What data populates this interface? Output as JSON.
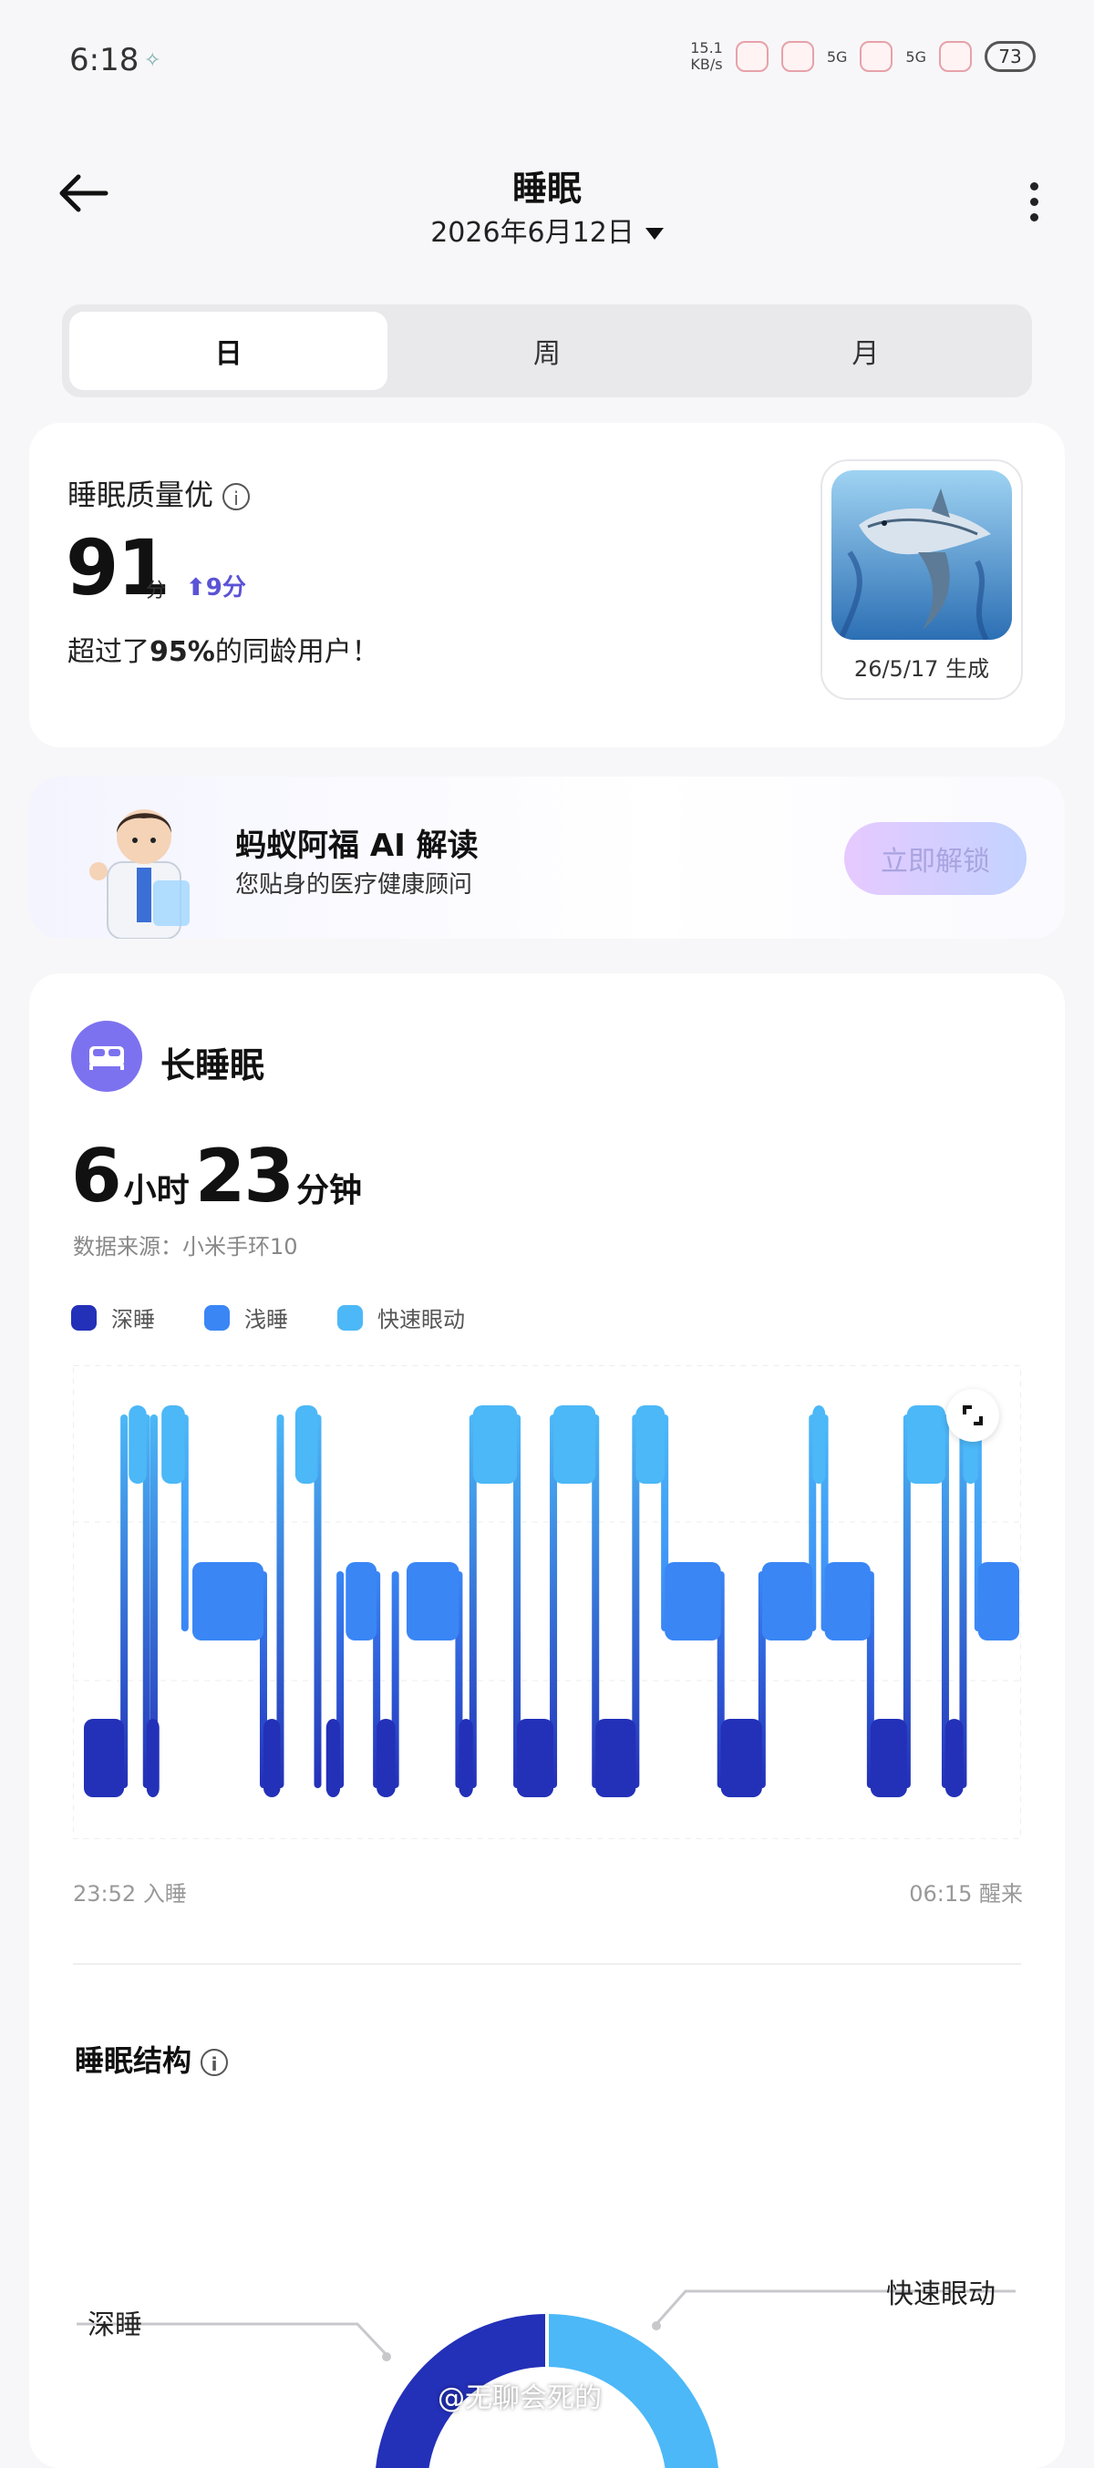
{
  "status": {
    "time": "6:18",
    "net_speed_value": "15.1",
    "net_speed_unit": "KB/s",
    "sig1": "5G",
    "sig2": "5G",
    "battery": "73"
  },
  "header": {
    "title": "睡眠",
    "date": "2026年6月12日"
  },
  "tabs": [
    {
      "label": "日",
      "active": true
    },
    {
      "label": "周",
      "active": false
    },
    {
      "label": "月",
      "active": false
    }
  ],
  "score_card": {
    "label": "睡眠质量优",
    "score": "91",
    "unit": "分",
    "delta": "9分",
    "compare_prefix": "超过了",
    "compare_pct": "95%",
    "compare_suffix": "的同龄用户！",
    "badge_caption": "26/5/17 生成"
  },
  "ai_card": {
    "title": "蚂蚁阿福 AI 解读",
    "subtitle": "您贴身的医疗健康顾问",
    "button": "立即解锁"
  },
  "sleep": {
    "section_title": "长睡眠",
    "hours": "6",
    "hours_unit": "小时",
    "minutes": "23",
    "minutes_unit": "分钟",
    "source": "数据来源：小米手环10",
    "start_time": "23:52",
    "start_label": "入睡",
    "end_time": "06:15",
    "end_label": "醒来",
    "structure_title": "睡眠结构",
    "structure_label_deep": "深睡",
    "structure_label_rem": "快速眼动"
  },
  "colors": {
    "deep": "#2330b8",
    "light": "#3a86f5",
    "rem": "#4cb8f7",
    "accent": "#7c72ef"
  },
  "chart_data": {
    "type": "bar",
    "legend": [
      "深睡",
      "浅睡",
      "快速眼动"
    ],
    "stages": [
      "快速眼动",
      "浅睡",
      "深睡"
    ],
    "segments": [
      {
        "stage": "深睡",
        "start": 0.0,
        "end": 4.3
      },
      {
        "stage": "快速眼动",
        "start": 4.8,
        "end": 6.7
      },
      {
        "stage": "深睡",
        "start": 6.7,
        "end": 7.5
      },
      {
        "stage": "快速眼动",
        "start": 8.3,
        "end": 10.8
      },
      {
        "stage": "浅睡",
        "start": 11.6,
        "end": 19.2
      },
      {
        "stage": "深睡",
        "start": 19.2,
        "end": 21.0
      },
      {
        "stage": "快速眼动",
        "start": 22.6,
        "end": 25.0
      },
      {
        "stage": "深睡",
        "start": 25.9,
        "end": 27.4
      },
      {
        "stage": "浅睡",
        "start": 28.0,
        "end": 31.3
      },
      {
        "stage": "深睡",
        "start": 31.3,
        "end": 33.3
      },
      {
        "stage": "浅睡",
        "start": 34.5,
        "end": 40.1
      },
      {
        "stage": "深睡",
        "start": 40.1,
        "end": 41.6
      },
      {
        "stage": "快速眼动",
        "start": 41.6,
        "end": 46.3
      },
      {
        "stage": "深睡",
        "start": 46.3,
        "end": 50.2
      },
      {
        "stage": "快速眼动",
        "start": 50.2,
        "end": 54.7
      },
      {
        "stage": "深睡",
        "start": 54.7,
        "end": 59.0
      },
      {
        "stage": "快速眼动",
        "start": 59.0,
        "end": 62.1
      },
      {
        "stage": "浅睡",
        "start": 62.1,
        "end": 68.1
      },
      {
        "stage": "深睡",
        "start": 68.1,
        "end": 72.5
      },
      {
        "stage": "浅睡",
        "start": 72.5,
        "end": 77.9
      },
      {
        "stage": "快速眼动",
        "start": 77.9,
        "end": 79.2
      },
      {
        "stage": "浅睡",
        "start": 79.2,
        "end": 84.1
      },
      {
        "stage": "深睡",
        "start": 84.1,
        "end": 88.0
      },
      {
        "stage": "快速眼动",
        "start": 88.0,
        "end": 92.1
      },
      {
        "stage": "深睡",
        "start": 92.1,
        "end": 94.0
      },
      {
        "stage": "快速眼动",
        "start": 94.0,
        "end": 95.6
      },
      {
        "stage": "浅睡",
        "start": 95.6,
        "end": 100.0
      }
    ],
    "x_start_label": "23:52 入睡",
    "x_end_label": "06:15 醒来",
    "grid": true
  },
  "watermark": "@无聊会死的"
}
